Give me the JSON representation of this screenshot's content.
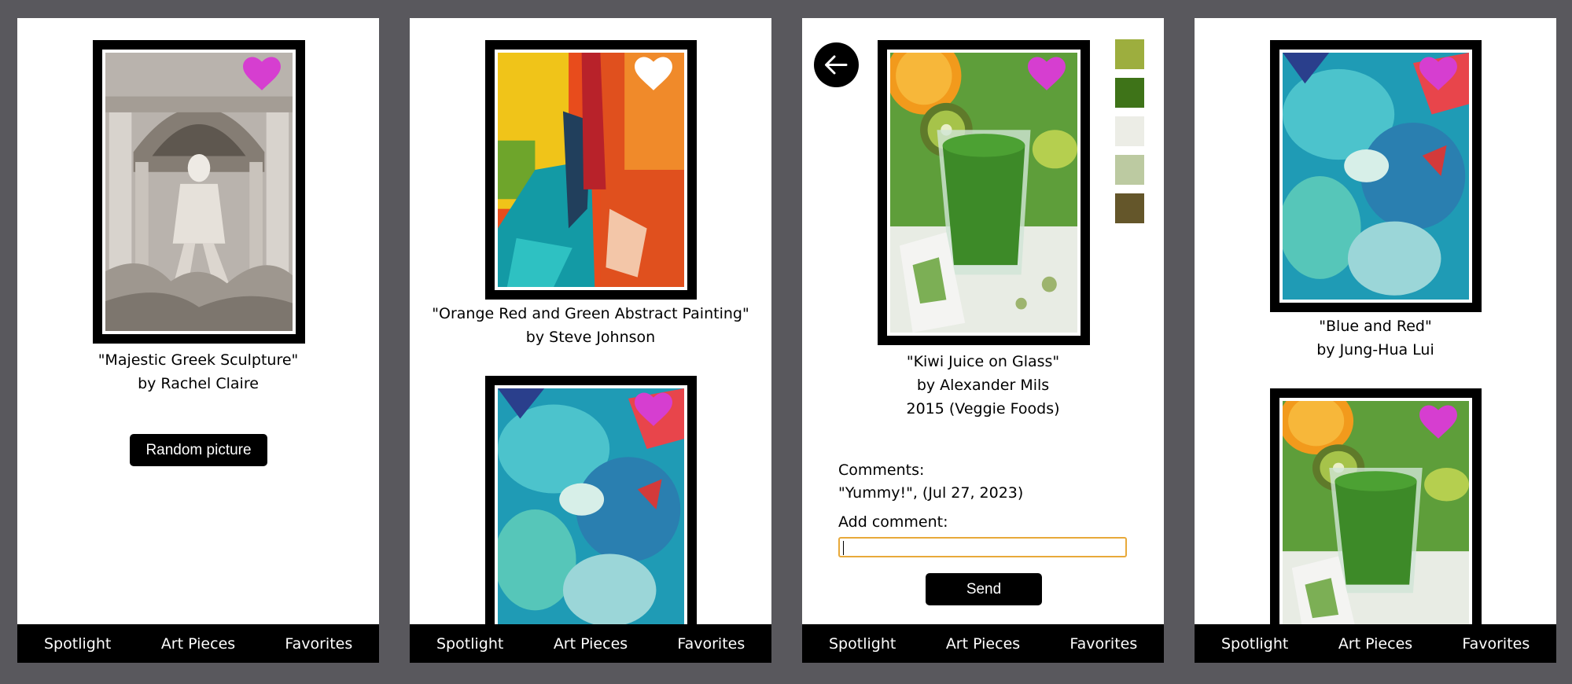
{
  "nav": {
    "spotlight": "Spotlight",
    "art_pieces": "Art Pieces",
    "favorites": "Favorites"
  },
  "colors": {
    "heart_active": "#d63ed0",
    "heart_inactive": "#ffffff",
    "input_focus": "#e8a93a",
    "backdrop": "#59585d"
  },
  "spotlight": {
    "title": "\"Majestic Greek Sculpture\"",
    "artist": "by Rachel Claire",
    "favorited": true,
    "random_button": "Random picture"
  },
  "art_pieces": {
    "items": [
      {
        "title": "\"Orange Red and Green Abstract Painting\"",
        "artist": "by Steve Johnson",
        "favorited": false
      },
      {
        "title": "\"Blue and Red\"",
        "artist": "by Jung-Hua Lui",
        "favorited": true
      }
    ]
  },
  "detail": {
    "title": "\"Kiwi Juice on Glass\"",
    "artist": "by Alexander Mils",
    "year_genre": "2015 (Veggie Foods)",
    "favorited": true,
    "palette": [
      "#9dae3e",
      "#3e7318",
      "#ecede6",
      "#bccaa1",
      "#64562a"
    ],
    "comments_label": "Comments:",
    "comments": [
      "\"Yummy!\", (Jul 27, 2023)"
    ],
    "add_comment_label": "Add comment:",
    "comment_value": "",
    "send_button": "Send",
    "back_icon": "arrow-left-icon"
  },
  "favorites": {
    "items": [
      {
        "title": "\"Blue and Red\"",
        "artist": "by Jung-Hua Lui",
        "favorited": true
      },
      {
        "title": "\"Kiwi Juice on Glass\"",
        "artist": "by Alexander Mils",
        "favorited": true
      }
    ]
  }
}
